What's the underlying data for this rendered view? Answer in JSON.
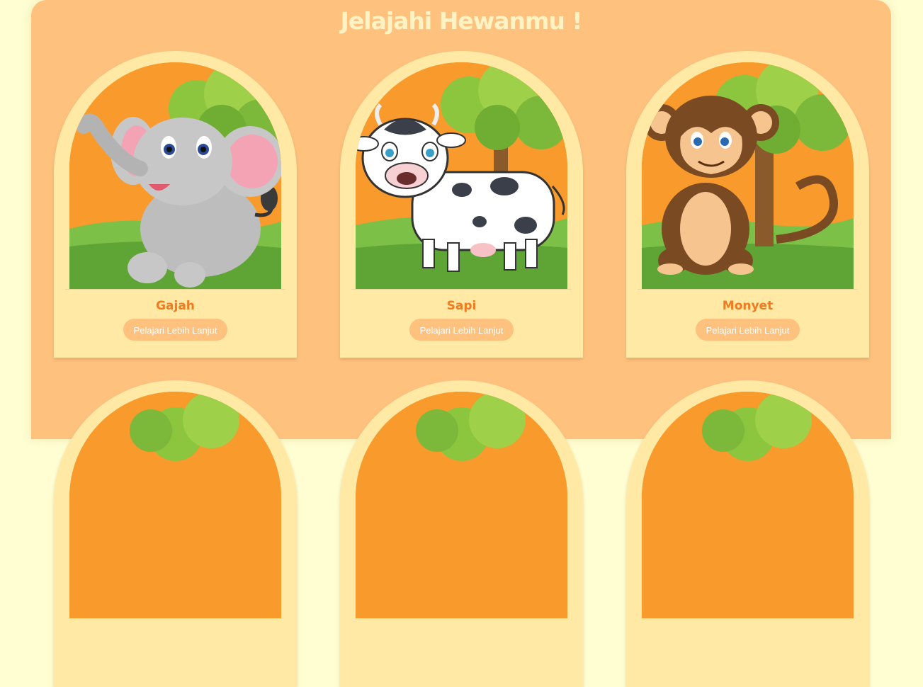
{
  "page": {
    "title": "Jelajahi Hewanmu !"
  },
  "cards": [
    {
      "name": "Gajah",
      "button_label": "Pelajari Lebih Lanjut",
      "image_icon": "elephant-icon"
    },
    {
      "name": "Sapi",
      "button_label": "Pelajari Lebih Lanjut",
      "image_icon": "cow-icon"
    },
    {
      "name": "Monyet",
      "button_label": "Pelajari Lebih Lanjut",
      "image_icon": "monkey-icon"
    }
  ],
  "colors": {
    "background": "#fefed2",
    "panel": "#ffc27e",
    "card": "#ffe9a4",
    "title": "#fff3c4",
    "name": "#f27a1f",
    "button": "#ffc27e",
    "scene_sky": "#f89a2c",
    "grass": "#7cc048",
    "tree": "#8cc63e"
  }
}
